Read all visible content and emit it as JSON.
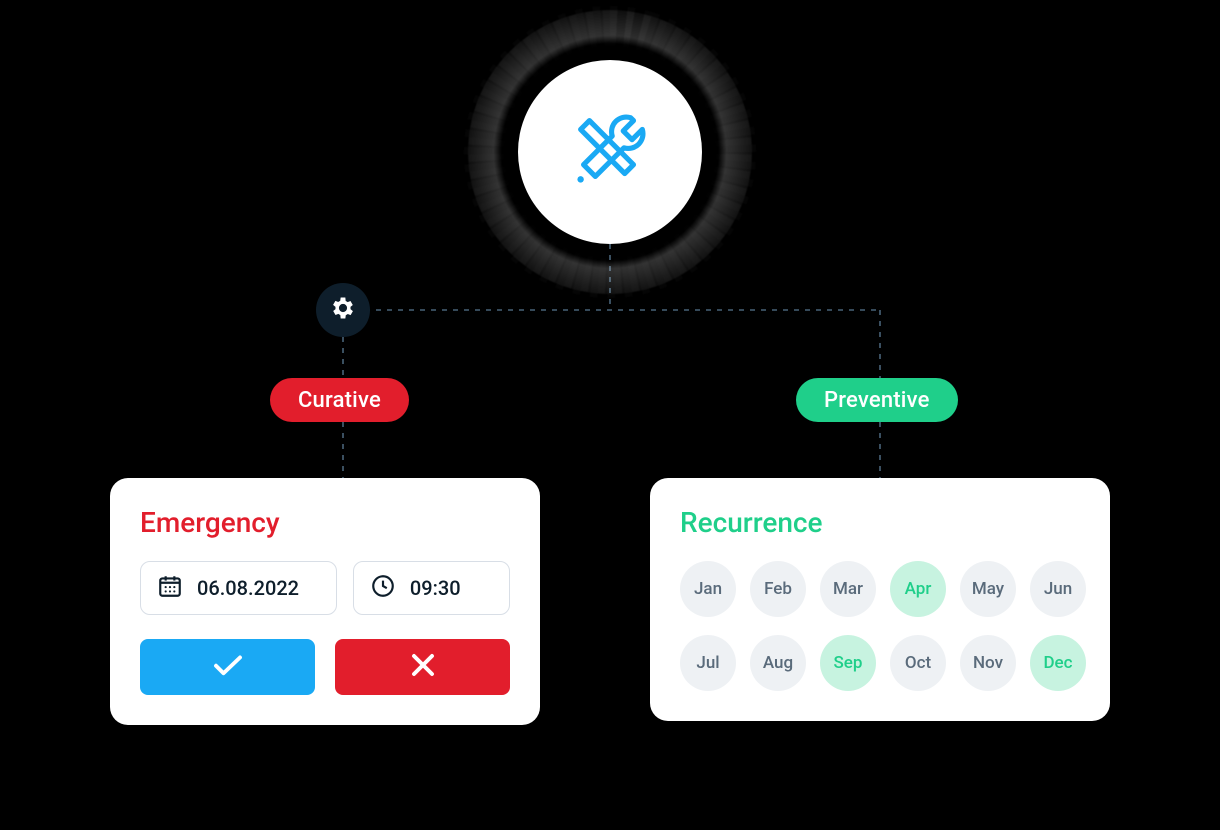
{
  "colors": {
    "curative": "#E21E2C",
    "preventive": "#1FCF8A",
    "confirm": "#1AA9F4",
    "tools_icon": "#1AA9F4",
    "dark": "#0E1E2B"
  },
  "pills": {
    "curative_label": "Curative",
    "preventive_label": "Preventive"
  },
  "emergency": {
    "title": "Emergency",
    "date": "06.08.2022",
    "time": "09:30"
  },
  "recurrence": {
    "title": "Recurrence",
    "months": [
      {
        "label": "Jan",
        "selected": false
      },
      {
        "label": "Feb",
        "selected": false
      },
      {
        "label": "Mar",
        "selected": false
      },
      {
        "label": "Apr",
        "selected": true
      },
      {
        "label": "May",
        "selected": false
      },
      {
        "label": "Jun",
        "selected": false
      },
      {
        "label": "Jul",
        "selected": false
      },
      {
        "label": "Aug",
        "selected": false
      },
      {
        "label": "Sep",
        "selected": true
      },
      {
        "label": "Oct",
        "selected": false
      },
      {
        "label": "Nov",
        "selected": false
      },
      {
        "label": "Dec",
        "selected": true
      }
    ]
  }
}
